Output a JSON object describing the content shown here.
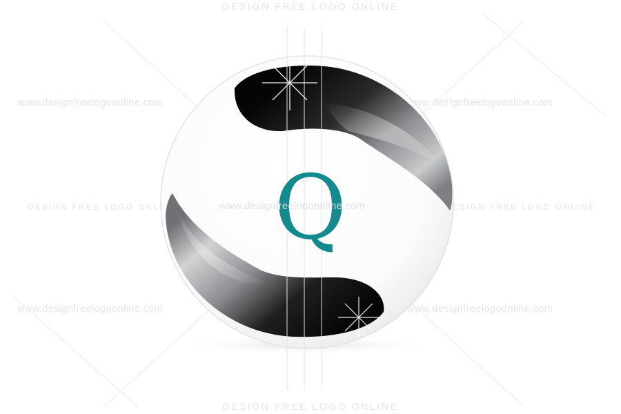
{
  "watermarks": {
    "caps_text": "DESIGN FREE LOGO ONLINE",
    "url_text": "www.designfreelogoonline.com"
  },
  "logo": {
    "letter": "Q",
    "letter_color": "#138a8f",
    "shell_colors": [
      "#0d0d0d",
      "#8a8c8f",
      "#d7d8da"
    ]
  }
}
